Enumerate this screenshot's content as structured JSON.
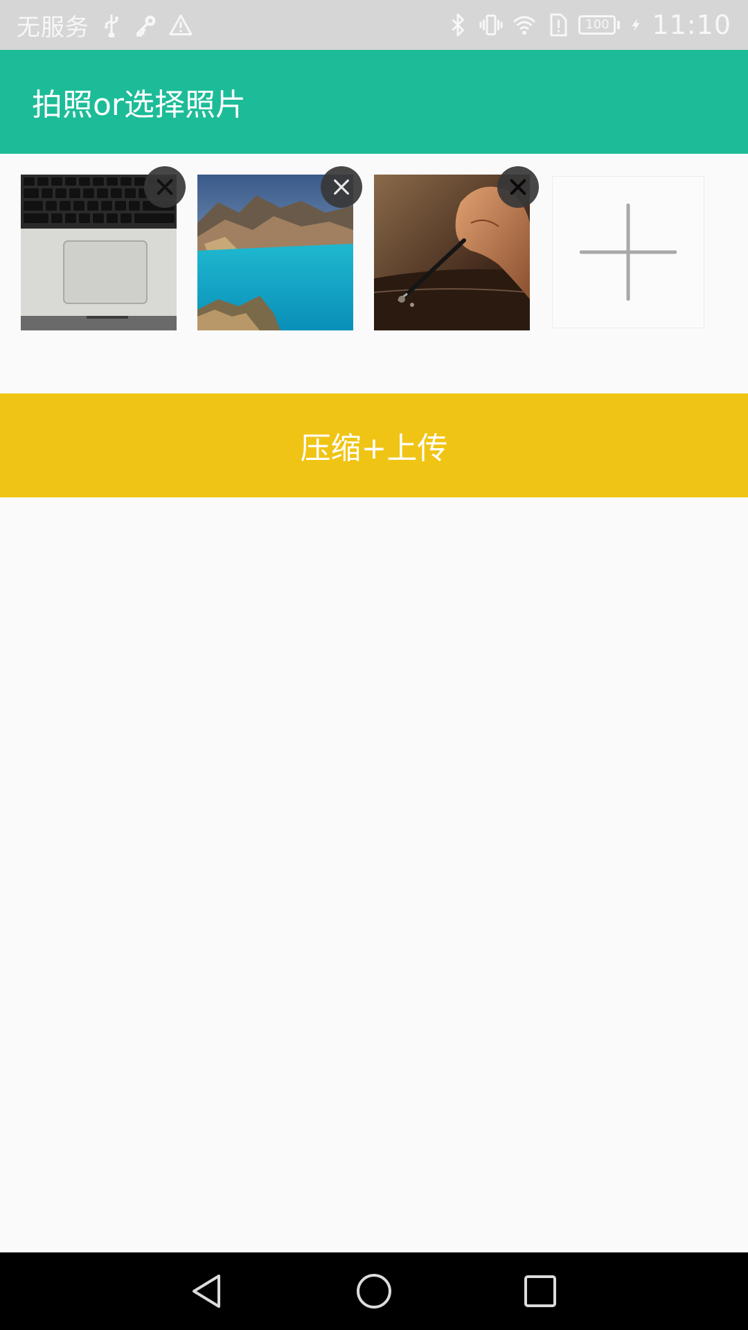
{
  "status_bar": {
    "carrier": "无服务",
    "battery": "100",
    "time": "11:10",
    "icons": [
      "usb-icon",
      "key-icon",
      "warning-icon",
      "bluetooth-icon",
      "vibrate-icon",
      "wifi-icon",
      "sim-alert-icon",
      "battery-icon",
      "charging-icon"
    ]
  },
  "app_bar": {
    "title": "拍照or选择照片"
  },
  "photos": [
    {
      "subject": "laptop keyboard and trackpad",
      "delete_icon": "close-icon"
    },
    {
      "subject": "mountain crater lake",
      "delete_icon": "close-icon"
    },
    {
      "subject": "hand with chisel",
      "delete_icon": "close-icon"
    }
  ],
  "add_tile": {
    "icon": "plus-icon"
  },
  "upload_button": {
    "label": "压缩+上传"
  },
  "colors": {
    "app_bar": "#1dbc98",
    "upload_button": "#f0c414",
    "status_bar": "#d6d6d6",
    "background": "#fafafa",
    "nav_bar": "#000000"
  },
  "nav_bar": {
    "icons": [
      "back-icon",
      "home-icon",
      "recents-icon"
    ]
  }
}
